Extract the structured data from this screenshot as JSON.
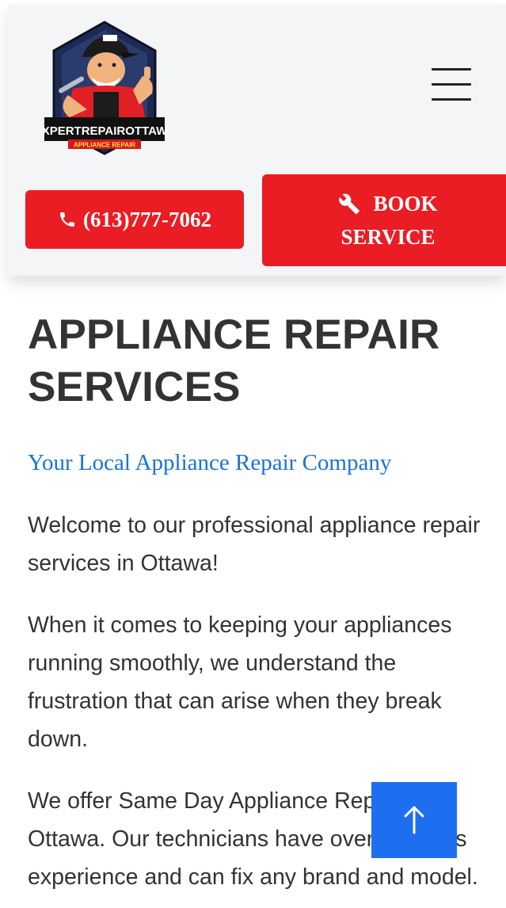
{
  "header": {
    "logo": {
      "brand_text": "EXPERTREPAIROTTAWA",
      "tagline": "APPLIANCE REPAIR"
    },
    "phone_button_label": "(613)777-7062",
    "book_button_line1": "BOOK",
    "book_button_line2": "SERVICE"
  },
  "main": {
    "title": "APPLIANCE REPAIR SERVICES",
    "subtitle": "Your Local Appliance Repair Company",
    "paragraphs": [
      "Welcome to our professional appliance repair services in Ottawa!",
      "When it comes to keeping your appliances running smoothly, we understand the frustration that can arise when they break down.",
      "We offer Same Day Appliance Repair in Ottawa. Our technicians have over 15 years experience and can fix any brand and model."
    ]
  },
  "scroll_top": {
    "icon": "arrow-up-icon"
  },
  "colors": {
    "accent_red": "#ea1c24",
    "link_blue": "#1a73d6",
    "scroll_button_blue": "#1e6ff0",
    "text": "#333333",
    "header_bg": "#f4f5f7"
  },
  "icons": {
    "menu": "hamburger-menu-icon",
    "phone": "phone-icon",
    "book": "wrench-icon"
  }
}
